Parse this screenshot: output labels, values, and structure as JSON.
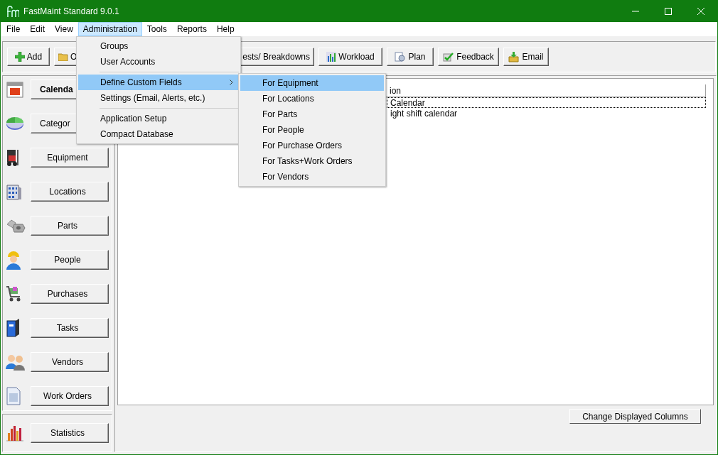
{
  "window": {
    "title": "FastMaint Standard 9.0.1"
  },
  "menu_bar": [
    {
      "label": "File",
      "selected": false
    },
    {
      "label": "Edit",
      "selected": false
    },
    {
      "label": "View",
      "selected": false
    },
    {
      "label": "Administration",
      "selected": true
    },
    {
      "label": "Tools",
      "selected": false
    },
    {
      "label": "Reports",
      "selected": false
    },
    {
      "label": "Help",
      "selected": false
    }
  ],
  "toolbar": [
    {
      "label": "Add",
      "kind": "add"
    },
    {
      "label": "O",
      "kind": "folder"
    },
    {
      "label": "ests/ Breakdowns",
      "kind": "covered"
    },
    {
      "label": "Workload",
      "kind": "chart"
    },
    {
      "label": "Plan",
      "kind": "plan"
    },
    {
      "label": "Feedback",
      "kind": "check"
    },
    {
      "label": "Email",
      "kind": "email"
    }
  ],
  "sidebar": {
    "items": [
      {
        "label": "Calenda",
        "kind": "calendar",
        "selected": true
      },
      {
        "label": "Categor",
        "kind": "pie",
        "selected": false
      },
      {
        "label": "Equipment",
        "kind": "forklift",
        "selected": false
      },
      {
        "label": "Locations",
        "kind": "building",
        "selected": false
      },
      {
        "label": "Parts",
        "kind": "parts",
        "selected": false
      },
      {
        "label": "People",
        "kind": "person",
        "selected": false
      },
      {
        "label": "Purchases",
        "kind": "cart",
        "selected": false
      },
      {
        "label": "Tasks",
        "kind": "binder",
        "selected": false
      },
      {
        "label": "Vendors",
        "kind": "people",
        "selected": false
      },
      {
        "label": "Work Orders",
        "kind": "document",
        "selected": false
      }
    ],
    "statistics": {
      "label": "Statistics",
      "kind": "bars",
      "selected": false
    }
  },
  "list": {
    "columns": [
      "ion"
    ],
    "rows": [
      {
        "text": "Calendar",
        "selected": true
      },
      {
        "text": "ight shift calendar",
        "selected": false
      }
    ]
  },
  "change_columns_button": "Change Displayed Columns",
  "admin_menu": {
    "items": [
      {
        "kind": "item",
        "label": "Groups",
        "selected": false
      },
      {
        "kind": "item",
        "label": "User Accounts",
        "selected": false
      },
      {
        "kind": "separator"
      },
      {
        "kind": "submenu",
        "label": "Define Custom Fields",
        "selected": true
      },
      {
        "kind": "item",
        "label": "Settings (Email, Alerts, etc.)",
        "selected": false
      },
      {
        "kind": "separator"
      },
      {
        "kind": "item",
        "label": "Application Setup",
        "selected": false
      },
      {
        "kind": "item",
        "label": "Compact Database",
        "selected": false
      }
    ]
  },
  "custom_fields_menu": {
    "items": [
      {
        "label": "For Equipment",
        "selected": true
      },
      {
        "label": "For Locations",
        "selected": false
      },
      {
        "label": "For Parts",
        "selected": false
      },
      {
        "label": "For People",
        "selected": false
      },
      {
        "label": "For Purchase Orders",
        "selected": false
      },
      {
        "label": "For Tasks+Work Orders",
        "selected": false
      },
      {
        "label": "For Vendors",
        "selected": false
      }
    ]
  }
}
